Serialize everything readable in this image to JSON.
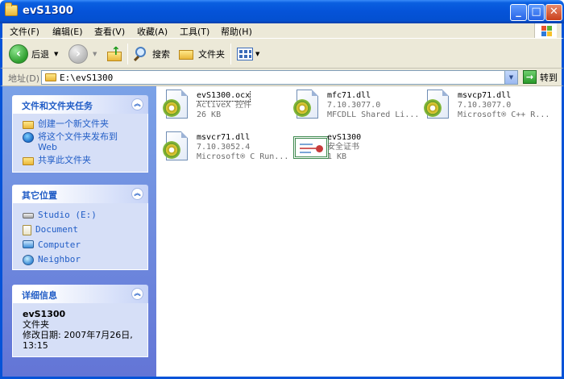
{
  "window": {
    "title": "evS1300"
  },
  "menu": [
    "文件(F)",
    "编辑(E)",
    "查看(V)",
    "收藏(A)",
    "工具(T)",
    "帮助(H)"
  ],
  "toolbar": {
    "back": "后退",
    "search": "搜索",
    "folders": "文件夹"
  },
  "address": {
    "label": "地址(D)",
    "path": "E:\\evS1300",
    "go": "转到"
  },
  "tasks_panel": {
    "title": "文件和文件夹任务",
    "items": [
      "创建一个新文件夹",
      "将这个文件夹发布到",
      "Web",
      "共享此文件夹"
    ]
  },
  "places_panel": {
    "title": "其它位置",
    "items": [
      "Studio (E:)",
      "Document",
      "Computer",
      "Neighbor"
    ]
  },
  "details_panel": {
    "title": "详细信息",
    "name": "evS1300",
    "type": "文件夹",
    "modified": "修改日期: 2007年7月26日,",
    "modified_time": "13:15"
  },
  "files": [
    {
      "name": "evS1300.ocx",
      "line2": "ActiveX 控件",
      "line3": "26 KB",
      "icon": "dll-gear-icon"
    },
    {
      "name": "mfc71.dll",
      "line2": "7.10.3077.0",
      "line3": "MFCDLL Shared Li...",
      "icon": "dll-gear-icon"
    },
    {
      "name": "msvcp71.dll",
      "line2": "7.10.3077.0",
      "line3": "Microsoft® C++ R...",
      "icon": "dll-gear-icon"
    },
    {
      "name": "msvcr71.dll",
      "line2": "7.10.3052.4",
      "line3": "Microsoft® C Run...",
      "icon": "dll-gear-icon"
    },
    {
      "name": "evS1300",
      "line2": "安全证书",
      "line3": "1 KB",
      "icon": "certificate-icon"
    }
  ]
}
